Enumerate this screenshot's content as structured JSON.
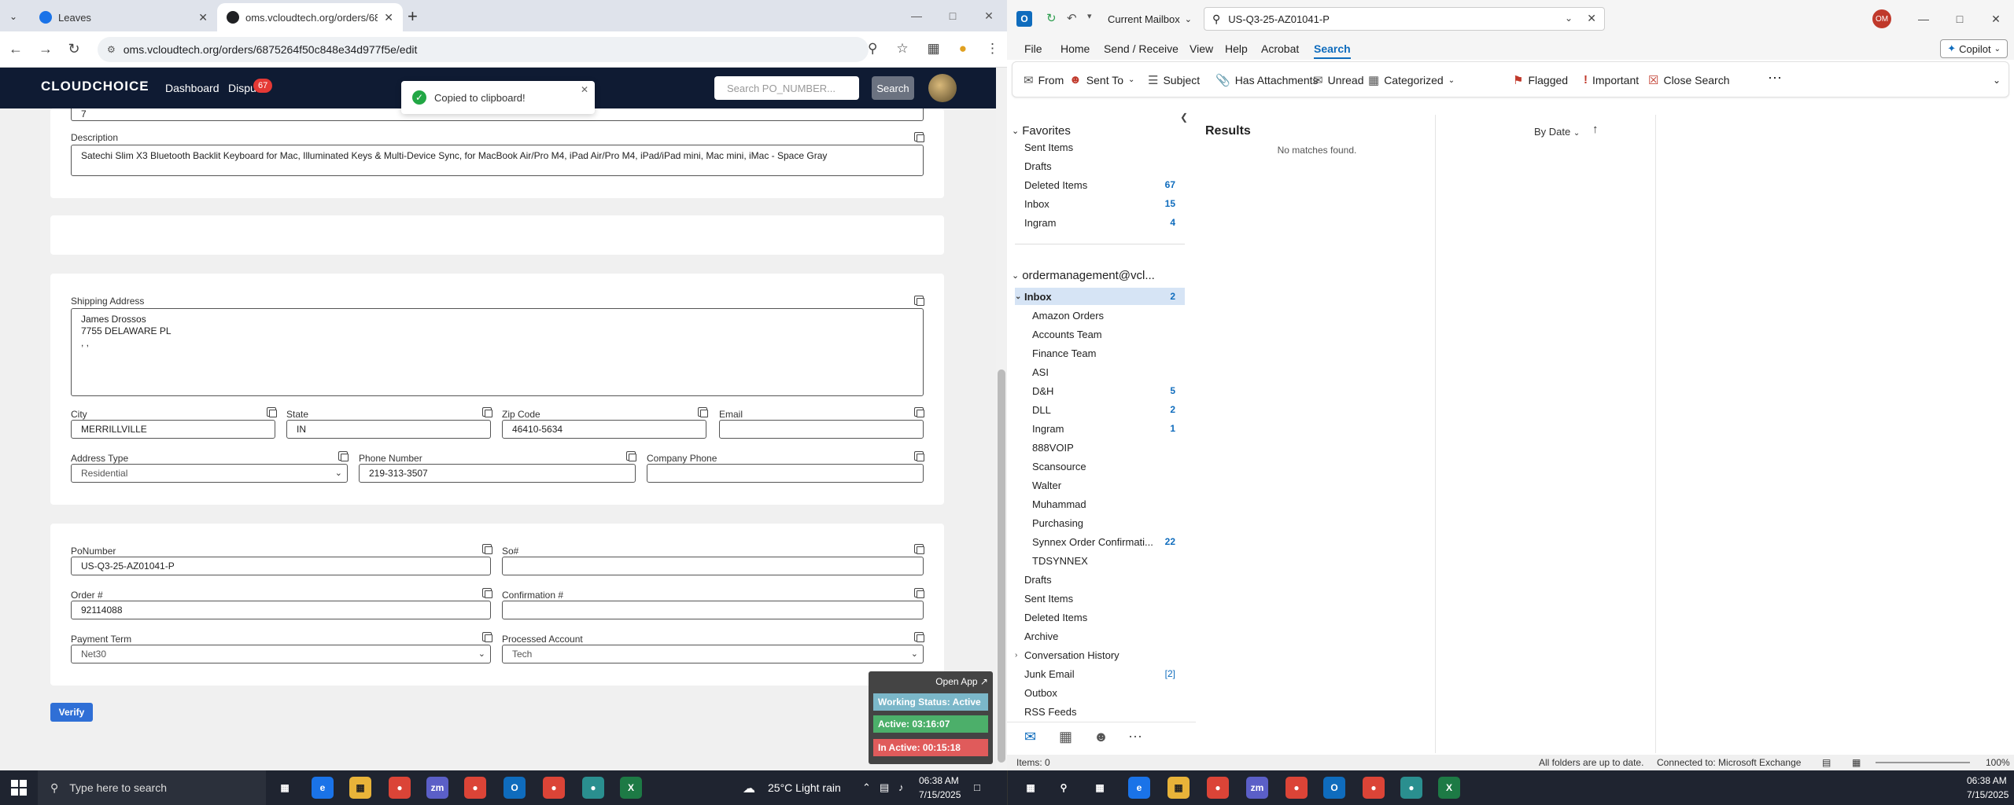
{
  "chrome": {
    "tabs": [
      {
        "title": "Leaves",
        "color": "#1a73e8"
      },
      {
        "title": "oms.vcloudtech.org/orders/687",
        "color": "#202124"
      }
    ],
    "url": "oms.vcloudtech.org/orders/6875264f50c848e34d977f5e/edit"
  },
  "app": {
    "logo": "CLOUDCHOICE",
    "nav": {
      "dashboard": "Dashboard",
      "disputes": "Dispu",
      "disputes_badge": "67"
    },
    "search_placeholder": "Search PO_NUMBER...",
    "search_button": "Search",
    "toast": "Copied to clipboard!",
    "top_partial_value": "7",
    "description_label": "Description",
    "description_value": "Satechi Slim X3 Bluetooth Backlit Keyboard for Mac, Illuminated Keys & Multi-Device Sync, for MacBook Air/Pro M4, iPad Air/Pro M4, iPad/iPad mini, Mac mini, iMac - Space Gray",
    "shipping": {
      "label": "Shipping Address",
      "value": "James Drossos\n7755 DELAWARE PL\n, ,",
      "city_label": "City",
      "city": "MERRILLVILLE",
      "state_label": "State",
      "state": "IN",
      "zip_label": "Zip Code",
      "zip": "46410-5634",
      "email_label": "Email",
      "email": "",
      "address_type_label": "Address Type",
      "address_type": "Residential",
      "phone_label": "Phone Number",
      "phone": "219-313-3507",
      "company_phone_label": "Company Phone",
      "company_phone": ""
    },
    "order": {
      "po_label": "PoNumber",
      "po": "US-Q3-25-AZ01041-P",
      "so_label": "So#",
      "so": "",
      "order_label": "Order #",
      "order": "92114088",
      "confirmation_label": "Confirmation #",
      "confirmation": "",
      "payment_label": "Payment Term",
      "payment": "Net30",
      "processed_label": "Processed Account",
      "processed": "Tech"
    },
    "verify": "Verify",
    "widget": {
      "open_app": "Open App ↗",
      "working": "Working Status: Active",
      "active": "Active: 03:16:07",
      "inactive": "In Active: 00:15:18"
    }
  },
  "outlook": {
    "scope": "Current Mailbox",
    "search_value": "US-Q3-25-AZ01041-P",
    "avatar": "OM",
    "menu": [
      "File",
      "Home",
      "Send / Receive",
      "View",
      "Help",
      "Acrobat",
      "Search"
    ],
    "copilot": "Copilot",
    "ribbon": [
      "From",
      "Sent To",
      "Subject",
      "Has Attachments",
      "Unread",
      "Categorized",
      "Flagged",
      "Important",
      "Close Search"
    ],
    "favorites_label": "Favorites",
    "favorites": [
      {
        "name": "Sent Items",
        "count": ""
      },
      {
        "name": "Drafts",
        "count": ""
      },
      {
        "name": "Deleted Items",
        "count": "67"
      },
      {
        "name": "Inbox",
        "count": "15"
      },
      {
        "name": "Ingram",
        "count": "4"
      }
    ],
    "account": "ordermanagement@vcl...",
    "inbox": {
      "name": "Inbox",
      "count": "2"
    },
    "inbox_children": [
      {
        "name": "Amazon Orders",
        "count": ""
      },
      {
        "name": "Accounts Team",
        "count": ""
      },
      {
        "name": "Finance Team",
        "count": ""
      },
      {
        "name": "ASI",
        "count": ""
      },
      {
        "name": "D&H",
        "count": "5"
      },
      {
        "name": "DLL",
        "count": "2"
      },
      {
        "name": "Ingram",
        "count": "1"
      },
      {
        "name": "888VOIP",
        "count": ""
      },
      {
        "name": "Scansource",
        "count": ""
      },
      {
        "name": "Walter",
        "count": ""
      },
      {
        "name": "Muhammad",
        "count": ""
      },
      {
        "name": "Purchasing",
        "count": ""
      },
      {
        "name": "Synnex Order Confirmati...",
        "count": "22"
      },
      {
        "name": "TDSYNNEX",
        "count": ""
      }
    ],
    "account_folders": [
      {
        "name": "Drafts",
        "count": ""
      },
      {
        "name": "Sent Items",
        "count": ""
      },
      {
        "name": "Deleted Items",
        "count": ""
      },
      {
        "name": "Archive",
        "count": ""
      },
      {
        "name": "Conversation History",
        "count": ""
      },
      {
        "name": "Junk Email",
        "count": "[2]"
      },
      {
        "name": "Outbox",
        "count": ""
      },
      {
        "name": "RSS Feeds",
        "count": ""
      }
    ],
    "results_title": "Results",
    "sort": "By Date",
    "no_match": "No matches found.",
    "status": {
      "items": "Items: 0",
      "sync": "All folders are up to date.",
      "conn": "Connected to: Microsoft Exchange",
      "zoom": "100%"
    }
  },
  "taskbar": {
    "search": "Type here to search",
    "weather": "25°C  Light rain",
    "time_left": "06:38 AM",
    "date_left": "7/15/2025",
    "time_right": "06:38 AM",
    "date_right": "7/15/2025"
  }
}
